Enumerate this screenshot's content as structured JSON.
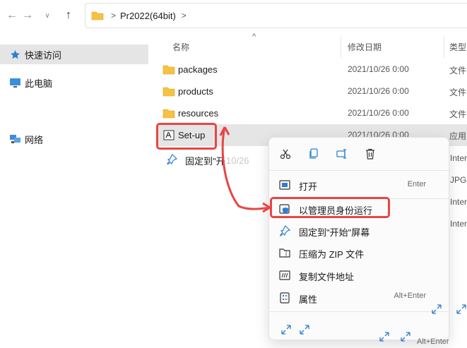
{
  "nav": {
    "back_icon": "arrow-left-icon",
    "forward_icon": "arrow-right-icon",
    "dropdown_icon": "chevron-down-icon",
    "up_icon": "arrow-up-icon"
  },
  "address": {
    "folder_icon": "folder-icon",
    "separator_1": ">",
    "crumb": "Pr2022(64bit)",
    "separator_2": ">"
  },
  "sidebar": {
    "items": [
      {
        "label": "快速访问",
        "icon": "star-icon",
        "active": true
      },
      {
        "label": "此电脑",
        "icon": "monitor-icon",
        "active": false
      },
      {
        "label": "网络",
        "icon": "network-icon",
        "active": false
      }
    ]
  },
  "columns": {
    "name": "名称",
    "modified": "修改日期",
    "type": "类型",
    "sort_caret": "^"
  },
  "files": [
    {
      "name": "packages",
      "date": "2021/10/26 0:00",
      "type": "文件",
      "icon": "folder-icon"
    },
    {
      "name": "products",
      "date": "2021/10/26 0:00",
      "type": "文件",
      "icon": "folder-icon"
    },
    {
      "name": "resources",
      "date": "2021/10/26 0:00",
      "type": "文件",
      "icon": "folder-icon"
    },
    {
      "name": "Set-up",
      "date": "2021/10/26 0:00",
      "type": "应用",
      "icon": "adobe-app-icon"
    }
  ],
  "ghost_row": {
    "pin_label": "固定到\"开",
    "ghost_date": "10/26",
    "type_1": "Inter",
    "type_2": "JPG",
    "type_3": "Inter",
    "type_4": "Inter"
  },
  "context_menu": {
    "quick_actions": [
      "cut-icon",
      "copy-icon",
      "rename-icon",
      "delete-icon"
    ],
    "items": [
      {
        "label": "打开",
        "shortcut": "Enter",
        "icon": "open-app-icon"
      },
      {
        "label": "以管理员身份运行",
        "shortcut": "",
        "icon": "shield-icon"
      },
      {
        "label": "固定到\"开始\"屏幕",
        "shortcut": "",
        "icon": "pin-icon"
      },
      {
        "label": "压缩为 ZIP 文件",
        "shortcut": "",
        "icon": "zip-icon"
      },
      {
        "label": "复制文件地址",
        "shortcut": "",
        "icon": "copy-path-icon"
      },
      {
        "label": "属性",
        "shortcut": "Alt+Enter",
        "icon": "properties-icon"
      }
    ]
  },
  "stray": {
    "shortcut": "Alt+Enter"
  },
  "colors": {
    "highlight": "#e84545",
    "selection": "#e5e5e5",
    "folder": "#f5c242",
    "accent": "#1a73c9"
  }
}
